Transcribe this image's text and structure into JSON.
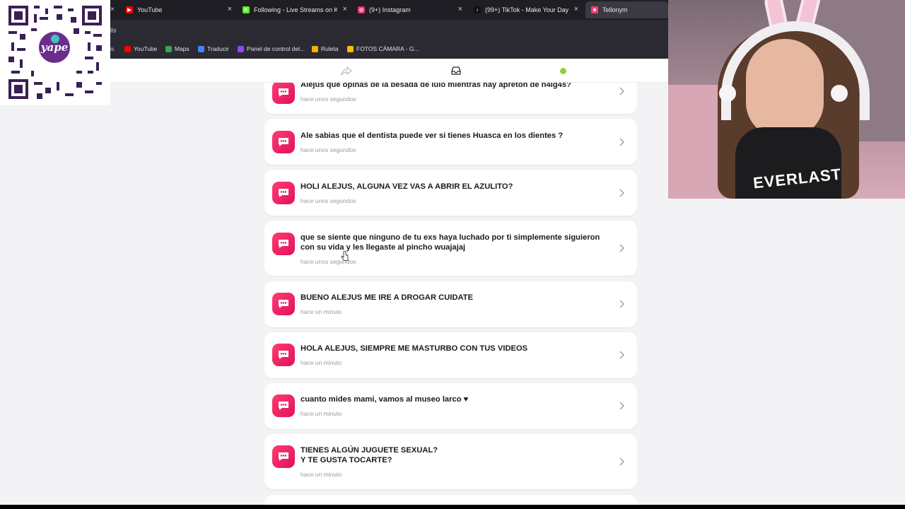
{
  "tabs": [
    {
      "title": "YouTube",
      "favicon_color": "#ff0000",
      "favicon_glyph": "▶"
    },
    {
      "title": "Following - Live Streams on Kick",
      "favicon_color": "#53fc18",
      "favicon_glyph": "K"
    },
    {
      "title": "(9+) Instagram",
      "favicon_color": "#e1306c",
      "favicon_glyph": "◎"
    },
    {
      "title": "(99+) TikTok - Make Your Day",
      "favicon_color": "#111111",
      "favicon_glyph": "♪"
    },
    {
      "title": "Tellonym",
      "favicon_color": "#ff3c6e",
      "favicon_glyph": "■"
    }
  ],
  "url_fragment": "lls",
  "bookmarks": [
    {
      "label": "YouTube",
      "color": "#ff0000"
    },
    {
      "label": "Maps",
      "color": "#34a853"
    },
    {
      "label": "Traducir",
      "color": "#4285f4"
    },
    {
      "label": "Panel de control del...",
      "color": "#9146ff"
    },
    {
      "label": "Ruleta",
      "color": "#f4b400"
    },
    {
      "label": "FOTOS CÁMARA - G...",
      "color": "#fbbc04"
    }
  ],
  "qr_badge": "yape",
  "webcam_shirt": "EVERLAST",
  "messages": [
    {
      "text": "Alejus que opinas de la besada de lulo mientras hay apreton de n4lg4s?",
      "time": "hace unos segundos"
    },
    {
      "text": "Ale sabias que el dentista puede ver si tienes Huasca en los dientes ?",
      "time": "hace unos segundos"
    },
    {
      "text": "HOLI ALEJUS, ALGUNA VEZ VAS A ABRIR EL AZULITO?",
      "time": "hace unos segundos"
    },
    {
      "text": "que se siente que ninguno de tu exs haya luchado por ti simplemente siguieron\ncon su vida y les llegaste al pincho wuajajaj",
      "time": "hace unos segundos"
    },
    {
      "text": "BUENO ALEJUS ME IRE  A DROGAR CUIDATE",
      "time": "hace un minuto"
    },
    {
      "text": "HOLA ALEJUS, SIEMPRE ME MASTURBO CON TUS VIDEOS",
      "time": "hace un minuto"
    },
    {
      "text": "cuanto mides mami, vamos al museo larco ♥",
      "time": "hace un minuto"
    },
    {
      "text": "TIENES ALGÚN JUGUETE SEXUAL?\nY TE GUSTA TOCARTE?",
      "time": "hace un minuto"
    }
  ],
  "colors": {
    "accent": "#ff3c6e",
    "online": "#8bd43a",
    "chrome_bg": "#2b2a33"
  }
}
